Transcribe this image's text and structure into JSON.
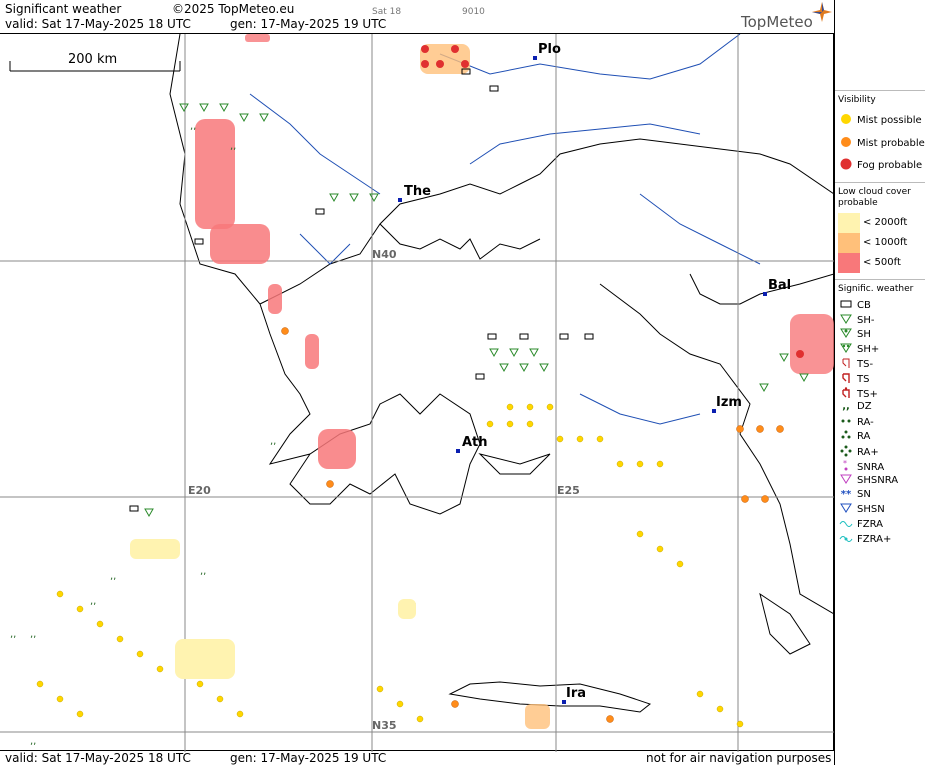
{
  "header": {
    "title": "Significant weather",
    "copyright": "©2025 TopMeteo.eu",
    "valid": "valid:  Sat  17-May-2025  18 UTC",
    "gen": "gen: 17-May-2025 19 UTC",
    "day_tag": "Sat 18",
    "code": "9010",
    "brand": "TopMeteo"
  },
  "footer": {
    "valid": "valid:  Sat  17-May-2025  18 UTC",
    "gen": "gen: 17-May-2025 19 UTC",
    "disclaimer": "not for air navigation purposes"
  },
  "map": {
    "scale_label": "200 km",
    "cities": [
      {
        "name": "Plo"
      },
      {
        "name": "The"
      },
      {
        "name": "Bal"
      },
      {
        "name": "Izm"
      },
      {
        "name": "Ath"
      },
      {
        "name": "Ira"
      }
    ],
    "grid_labels": {
      "n40": "N40",
      "n35": "N35",
      "e20": "E20",
      "e25": "E25"
    }
  },
  "legend": {
    "visibility": {
      "title": "Visibility",
      "items": [
        "Mist possible",
        "Mist probable",
        "Fog probable"
      ]
    },
    "low_cloud": {
      "title": "Low cloud cover probable",
      "items": [
        "< 2000ft",
        "< 1000ft",
        "<   500ft"
      ],
      "colors": [
        "#fff3b0",
        "#ffc07a",
        "#f8787a"
      ]
    },
    "signif": {
      "title": "Signific. weather",
      "items": [
        "CB",
        "SH-",
        "SH",
        "SH+",
        "TS-",
        "TS",
        "TS+",
        "DZ",
        "RA-",
        "RA",
        "RA+",
        "SNRA",
        "SHSNRA",
        "SN",
        "SHSN",
        "FZRA",
        "FZRA+"
      ]
    }
  }
}
